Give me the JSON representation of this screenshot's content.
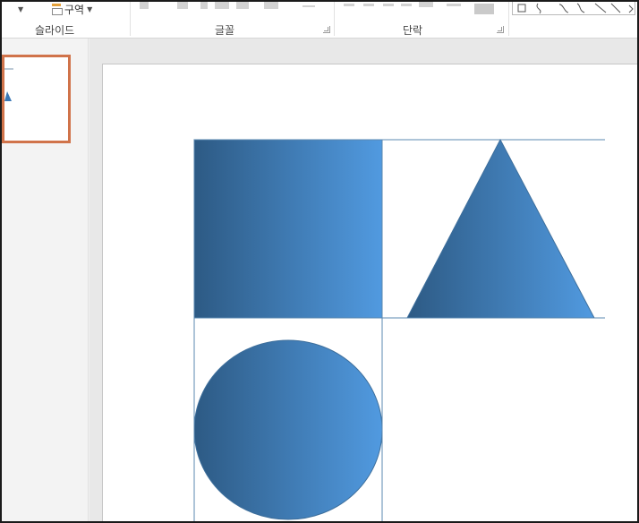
{
  "ribbon": {
    "groups": [
      {
        "label": "슬라이드"
      },
      {
        "label": "글꼴"
      },
      {
        "label": "단락"
      }
    ],
    "section_button_label": "구역"
  },
  "colors": {
    "gradient_start": "#2d5a84",
    "gradient_end": "#519ae0",
    "guide_line": "#5b88b0",
    "thumbnail_border": "#d0734a"
  },
  "icons": {
    "section": "section-icon",
    "dropdown": "chevron-down-icon",
    "dialog_launcher": "dialog-launcher-icon"
  },
  "slide": {
    "shapes": [
      {
        "type": "rectangle",
        "name": "gradient-rectangle"
      },
      {
        "type": "triangle",
        "name": "gradient-triangle"
      },
      {
        "type": "ellipse",
        "name": "gradient-circle"
      }
    ]
  }
}
